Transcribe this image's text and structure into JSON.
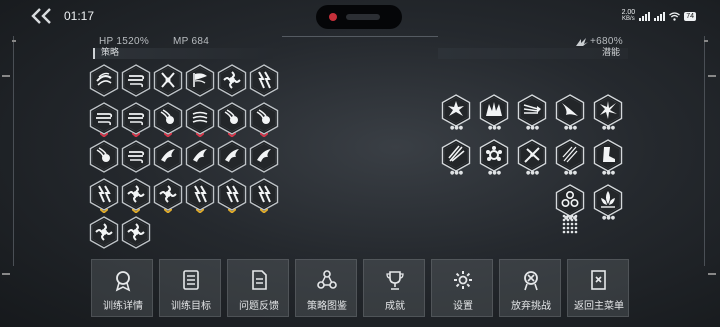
{
  "status_bar": {
    "time": "01:17",
    "net_speed_value": "2.00",
    "net_speed_unit": "KB/s",
    "battery": "74"
  },
  "stats": {
    "hp": "HP 1520%",
    "mp": "MP 684",
    "potential_value": "+680%"
  },
  "sections": {
    "strategy": "策略",
    "potential": "潜能"
  },
  "strategy_icons": [
    [
      "wind-swirl",
      "wind-gust",
      "scissor-cross",
      "wind-flag",
      "shuriken-spin",
      "lightning-claw"
    ],
    [
      "wind-gust-lines",
      "wind-gust-lines",
      "fireball",
      "wind-ripple",
      "flame-orb",
      "flame-orb"
    ],
    [
      "fireball-drop",
      "wind-gust-lines",
      "blade-wing",
      "blade-wing",
      "blade-wing",
      "blade-wing"
    ],
    [
      "lightning-claw",
      "shuriken-spin",
      "shuriken-spin",
      "lightning-claw",
      "lightning-claw",
      "lightning-claw"
    ],
    [
      "shuriken-spin",
      "shuriken-spin"
    ]
  ],
  "strategy_rank_colors": [
    [
      "none",
      "none",
      "none",
      "none",
      "none",
      "none"
    ],
    [
      "red",
      "red",
      "red",
      "red",
      "red",
      "red"
    ],
    [
      "none",
      "none",
      "none",
      "none",
      "none",
      "none"
    ],
    [
      "gold",
      "gold",
      "gold",
      "gold",
      "gold",
      "gold"
    ],
    [
      "none",
      "none"
    ]
  ],
  "potential_icons": [
    [
      "burst-star",
      "crystal-crown",
      "arrow-volley",
      "bird-dive",
      "impact-spark"
    ],
    [
      "feather-spray",
      "gear-flower",
      "blade-cross",
      "triple-slash",
      "dash-boot"
    ],
    [
      "triple-orb",
      "lotus-flame"
    ]
  ],
  "menu": [
    {
      "label": "训练详情",
      "icon": "medal-icon"
    },
    {
      "label": "训练目标",
      "icon": "checklist-icon"
    },
    {
      "label": "问题反馈",
      "icon": "document-icon"
    },
    {
      "label": "策略图鉴",
      "icon": "triangle-nodes-icon"
    },
    {
      "label": "成就",
      "icon": "trophy-icon"
    },
    {
      "label": "设置",
      "icon": "gear-icon"
    },
    {
      "label": "放弃挑战",
      "icon": "forfeit-icon"
    },
    {
      "label": "返回主菜单",
      "icon": "exit-door-icon"
    }
  ]
}
